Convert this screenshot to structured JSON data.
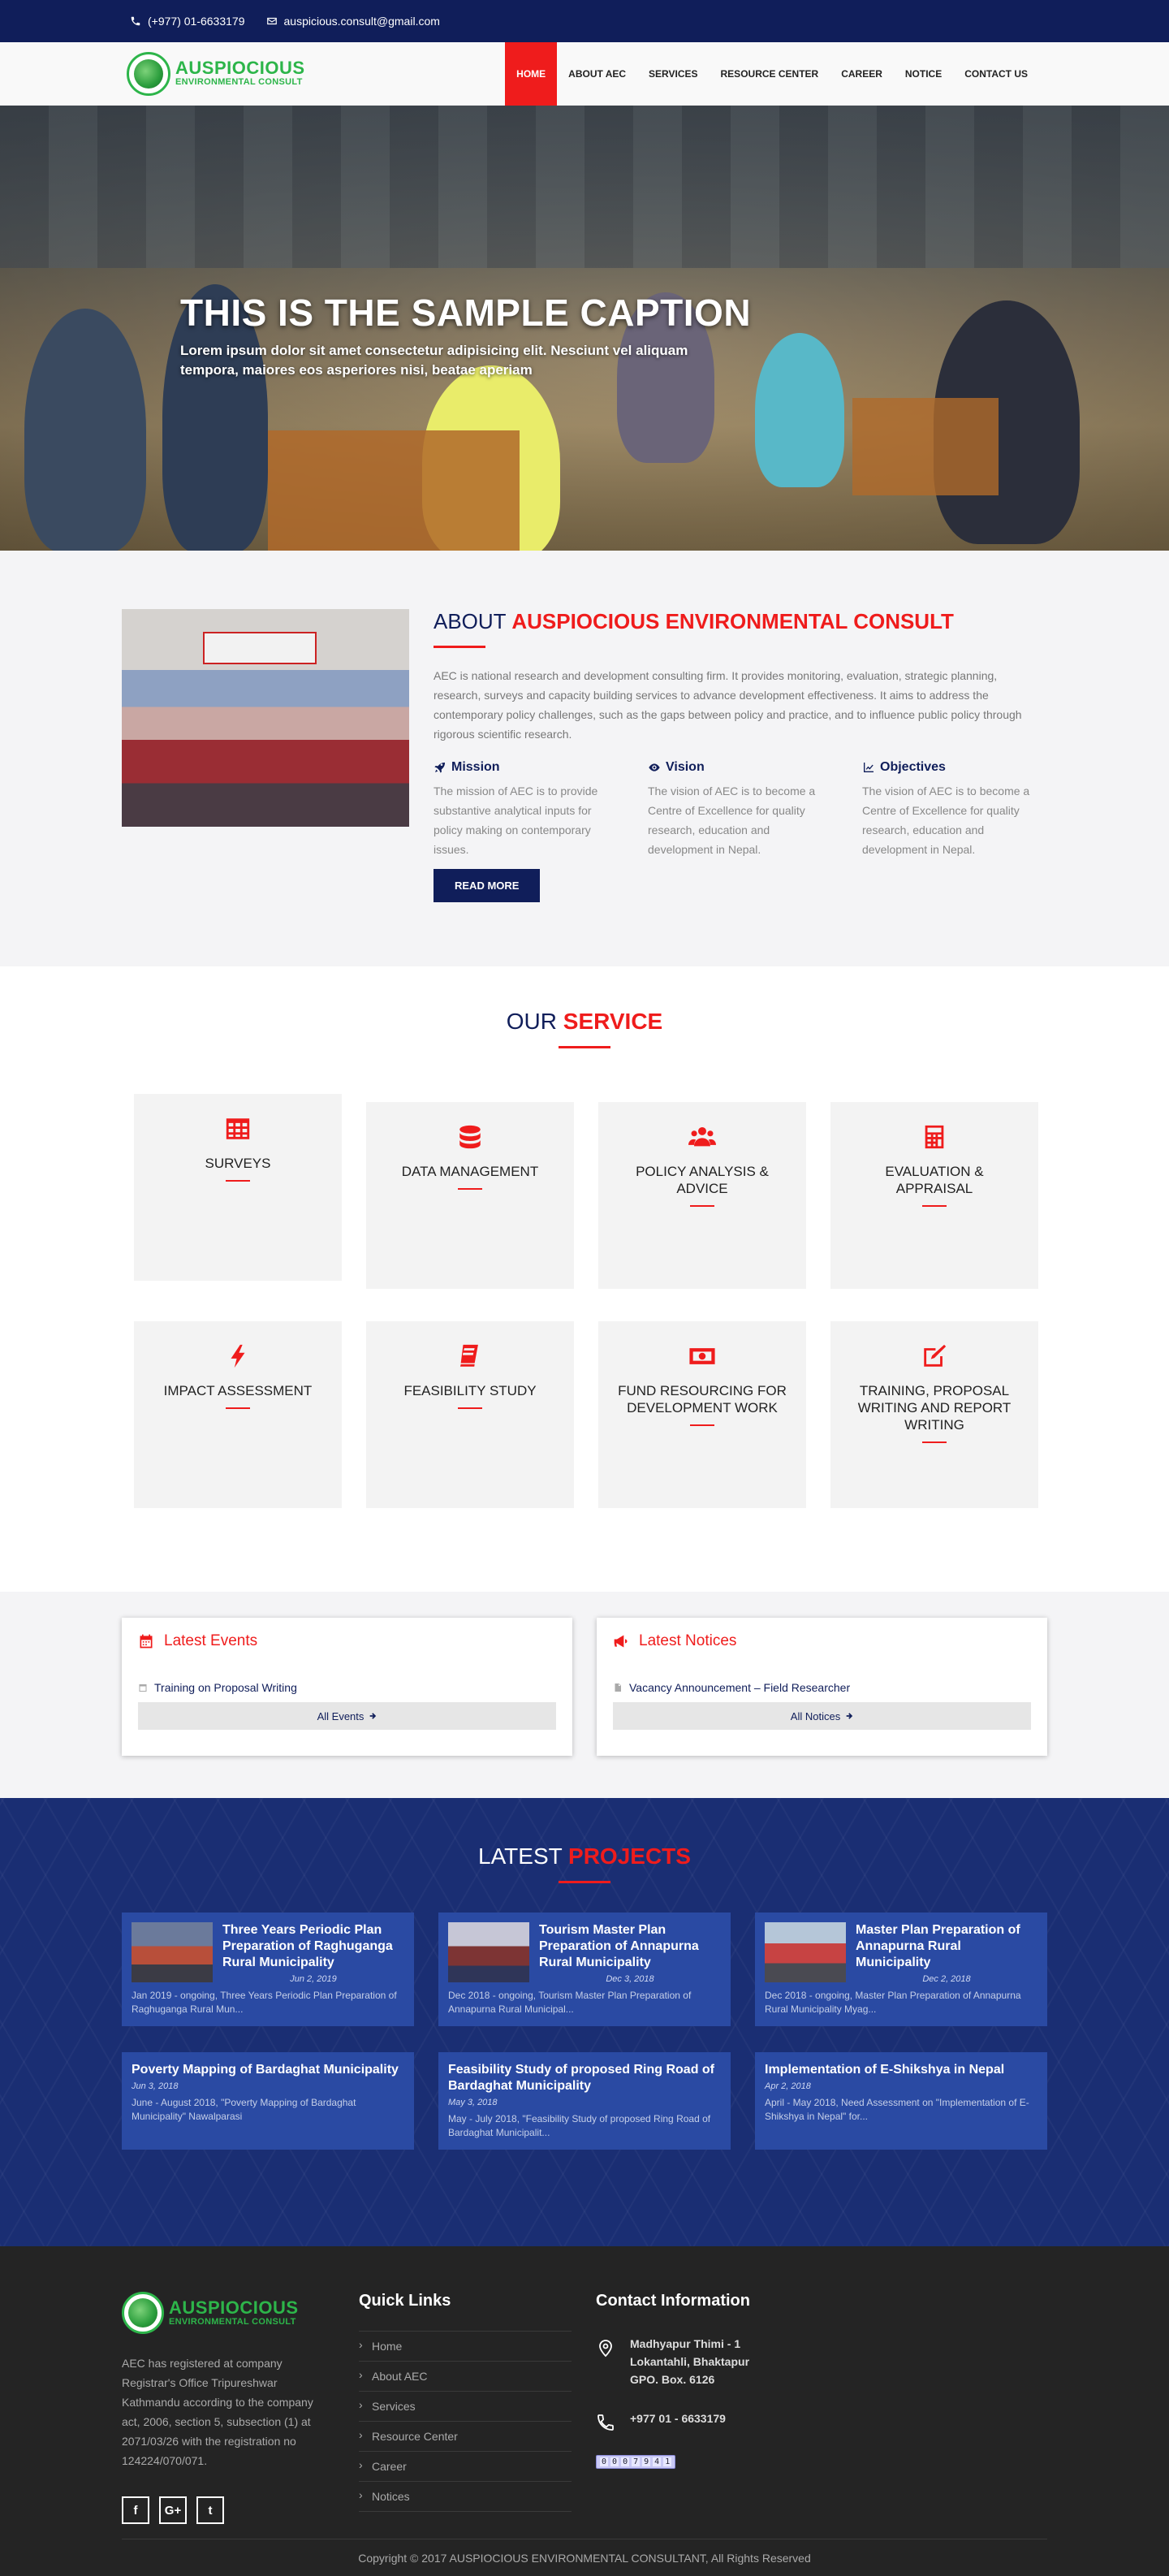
{
  "topbar": {
    "phone": "(+977) 01-6633179",
    "email": "auspicious.consult@gmail.com"
  },
  "brand": {
    "name": "AUSPIOCIOUS",
    "tagline": "ENVIRONMENTAL CONSULT",
    "color": "#2db54a"
  },
  "nav": {
    "items": [
      "HOME",
      "ABOUT AEC",
      "SERVICES",
      "RESOURCE CENTER",
      "CAREER",
      "NOTICE",
      "CONTACT US"
    ],
    "active": "HOME"
  },
  "hero": {
    "title": "THIS IS THE SAMPLE CAPTION",
    "text": "Lorem ipsum dolor sit amet consectetur adipisicing elit. Nesciunt vel aliquam tempora, maiores eos asperiores nisi, beatae aperiam"
  },
  "about": {
    "title_prefix": "ABOUT",
    "title_highlight": "AUSPIOCIOUS ENVIRONMENTAL CONSULT",
    "description": "AEC is national research and development consulting firm. It provides monitoring, evaluation, strategic planning, research, surveys and capacity building services to advance development effectiveness. It aims to address the contemporary policy challenges, such as the gaps between policy and practice, and to influence public policy through rigorous scientific research.",
    "mission_title": "Mission",
    "mission_text": "The mission of AEC is to provide substantive analytical inputs for policy making on contemporary issues.",
    "vision_title": "Vision",
    "vision_text": "The vision of AEC is to become a Centre of Excellence for quality research, education and development in Nepal.",
    "objectives_title": "Objectives",
    "objectives_text": "The vision of AEC is to become a Centre of Excellence for quality research, education and development in Nepal.",
    "button": "READ MORE"
  },
  "services": {
    "title_prefix": "OUR",
    "title_highlight": "SERVICE",
    "items": [
      "SURVEYS",
      "DATA MANAGEMENT",
      "POLICY ANALYSIS & ADVICE",
      "EVALUATION & APPRAISAL",
      "IMPACT ASSESSMENT",
      "FEASIBILITY STUDY",
      "FUND RESOURCING FOR DEVELOPMENT WORK",
      "TRAINING, PROPOSAL WRITING AND REPORT WRITING"
    ]
  },
  "events": {
    "title": "Latest Events",
    "entry": "Training on Proposal Writing",
    "all": "All Events"
  },
  "notices": {
    "title": "Latest Notices",
    "entry": "Vacancy Announcement – Field Researcher",
    "all": "All Notices"
  },
  "projects": {
    "title_prefix": "LATEST",
    "title_highlight": "PROJECTS",
    "items": [
      {
        "title": "Three Years Periodic Plan Preparation of Raghuganga Rural Municipality",
        "date": "Jun 2, 2019",
        "excerpt": "Jan 2019 - ongoing, Three Years Periodic Plan Preparation of Raghuganga Rural Mun..."
      },
      {
        "title": "Tourism Master Plan Preparation of Annapurna Rural Municipality",
        "date": "Dec 3, 2018",
        "excerpt": "Dec 2018 - ongoing, Tourism Master Plan Preparation of Annapurna Rural Municipal..."
      },
      {
        "title": "Master Plan Preparation of Annapurna Rural Municipality",
        "date": "Dec 2, 2018",
        "excerpt": "Dec 2018 - ongoing, Master Plan Preparation of Annapurna Rural Municipality Myag..."
      },
      {
        "title": "Poverty Mapping of Bardaghat Municipality",
        "date": "Jun 3, 2018",
        "excerpt": "June - August 2018, \"Poverty Mapping of Bardaghat Municipality\" Nawalparasi"
      },
      {
        "title": "Feasibility Study of proposed Ring Road of Bardaghat Municipality",
        "date": "May 3, 2018",
        "excerpt": "May - July 2018, \"Feasibility Study of proposed Ring Road of Bardaghat Municipalit..."
      },
      {
        "title": "Implementation of E-Shikshya in Nepal",
        "date": "Apr 2, 2018",
        "excerpt": "April - May 2018, Need Assessment on \"Implementation of E-Shikshya in Nepal\" for..."
      }
    ]
  },
  "footer": {
    "about": "AEC has registered at company Registrar's Office Tripureshwar Kathmandu according to the company act, 2006, section 5, subsection (1) at 2071/03/26 with the registration no 124224/070/071.",
    "social": [
      "f",
      "G+",
      "t"
    ],
    "quick_links_title": "Quick Links",
    "quick_links": [
      "Home",
      "About AEC",
      "Services",
      "Resource Center",
      "Career",
      "Notices"
    ],
    "contact_title": "Contact Information",
    "address_line1": "Madhyapur Thimi - 1",
    "address_line2": "Lokantahli, Bhaktapur",
    "address_line3": "GPO. Box. 6126",
    "phone": "+977 01 - 6633179",
    "counter": [
      "0",
      "0",
      "0",
      "7",
      "9",
      "4",
      "1"
    ],
    "copyright": "Copyright © 2017 AUSPIOCIOUS ENVIRONMENTAL CONSULTANT, All Rights Reserved"
  },
  "colors": {
    "navy": "#101e5a",
    "accent_red": "#ef1c1c",
    "project_blue": "#1a2e73",
    "card_blue": "#2a4aa3"
  }
}
